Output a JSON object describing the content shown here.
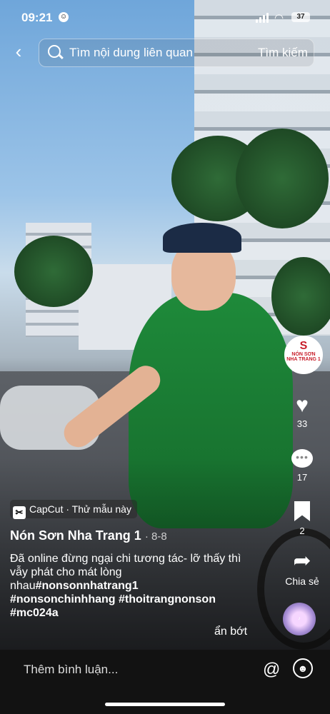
{
  "status_bar": {
    "time": "09:21",
    "battery": "37"
  },
  "search": {
    "placeholder": "Tìm nội dung liên quan",
    "button": "Tìm kiếm"
  },
  "rail": {
    "shop_avatar_brand": "NÓN SƠN",
    "shop_avatar_city": "NHA TRANG 1",
    "likes": "33",
    "comments": "17",
    "saves": "2",
    "share_label": "Chia sẻ"
  },
  "caption": {
    "template_label": "CapCut · Thử mẫu này",
    "author": "Nón Sơn Nha Trang 1",
    "date": "· 8-8",
    "description": "Đã online đừng ngại chi tương tác- lỡ thấy thì vẫy phát cho mát lòng nhau",
    "tag_inline": "#nonsonnhatrang1",
    "tags": "#nonsonchinhhang #thoitrangnonson #mc024a",
    "collapse": "ẩn bớt"
  },
  "comment_bar": {
    "placeholder": "Thêm bình luận..."
  },
  "icons": {
    "back": "chevron-left-icon",
    "search": "search-icon",
    "like": "heart-icon",
    "comment": "comment-bubble-icon",
    "save": "bookmark-icon",
    "share": "share-arrow-icon",
    "mention": "at-icon",
    "emoji": "emoji-icon"
  }
}
